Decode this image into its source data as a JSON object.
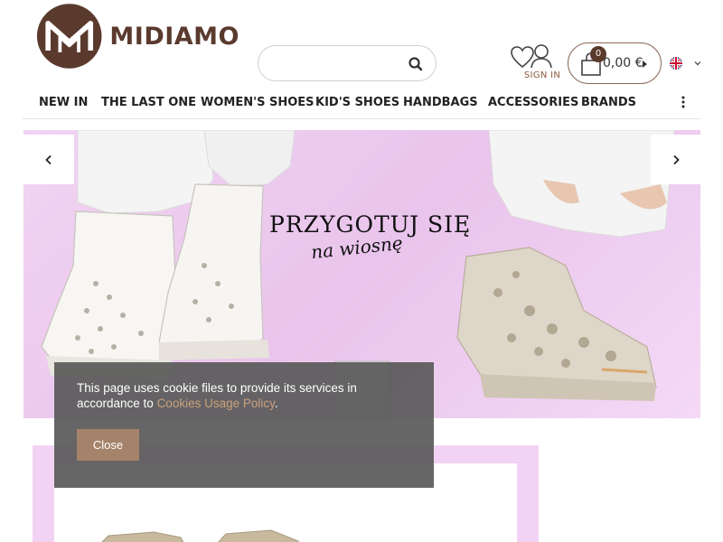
{
  "header": {
    "logo_text": "MIDIAMO",
    "search": {
      "placeholder": ""
    },
    "sign_in_label": "SIGN IN",
    "cart": {
      "count": "0",
      "total": "0,00 €"
    },
    "language": "en"
  },
  "nav": {
    "items": [
      {
        "label": "NEW IN"
      },
      {
        "label": "THE LAST ONE"
      },
      {
        "label": "WOMEN'S SHOES"
      },
      {
        "label": "KID'S SHOES"
      },
      {
        "label": "HANDBAGS"
      },
      {
        "label": "ACCESSORIES"
      },
      {
        "label": "BRANDS"
      }
    ]
  },
  "banner": {
    "title": "PRZYGOTUJ SIĘ",
    "subtitle": "na wiosnę"
  },
  "cookie": {
    "text_before": "This page uses cookie files to provide its services in accordance to ",
    "link_text": "Cookies Usage Policy",
    "text_after": ".",
    "close_label": "Close"
  },
  "colors": {
    "brand": "#5b3a2e",
    "accent": "#a5826a",
    "banner_bg": "#efcff1",
    "cookie_bg": "#5a5a5a"
  }
}
